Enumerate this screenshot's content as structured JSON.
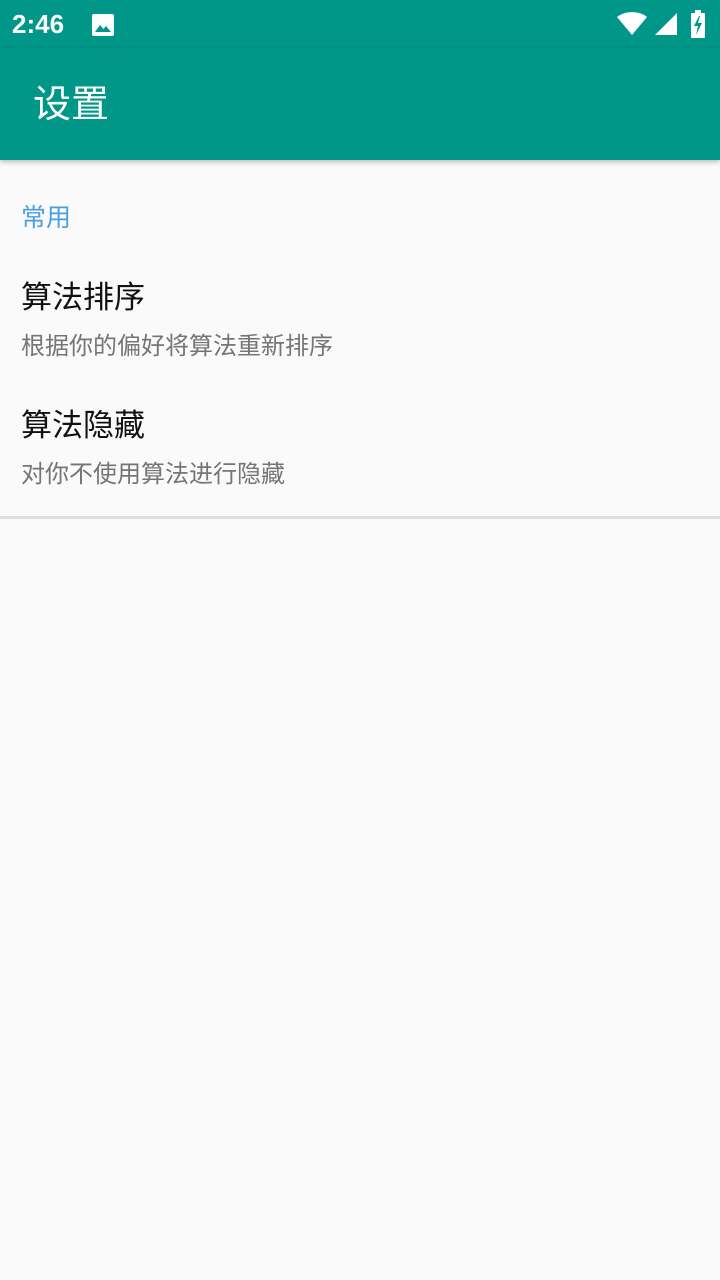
{
  "status_bar": {
    "time": "2:46",
    "icons": [
      "image-icon",
      "wifi-icon",
      "signal-icon",
      "battery-charging-icon"
    ],
    "background": "#009688"
  },
  "toolbar": {
    "title": "设置",
    "background": "#009688"
  },
  "preferences": {
    "category": {
      "title": "常用",
      "color": "#4a9fe0"
    },
    "items": [
      {
        "title": "算法排序",
        "summary": "根据你的偏好将算法重新排序"
      },
      {
        "title": "算法隐藏",
        "summary": "对你不使用算法进行隐藏"
      }
    ]
  }
}
